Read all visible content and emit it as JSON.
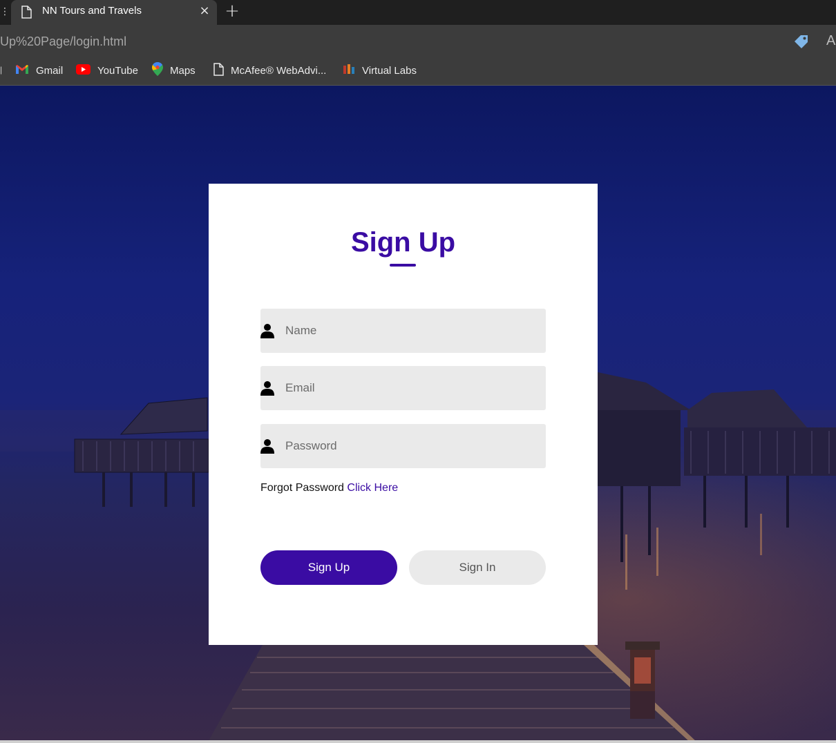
{
  "browser": {
    "tab_title": "NN Tours and Travels",
    "tab_close": "×",
    "new_tab": "+",
    "url": "Up%20Page/login.html",
    "read_aloud": "A",
    "bookmarks": [
      {
        "label": "Gmail",
        "icon": "gmail-icon"
      },
      {
        "label": "YouTube",
        "icon": "youtube-icon"
      },
      {
        "label": "Maps",
        "icon": "maps-icon"
      },
      {
        "label": "McAfee® WebAdvi...",
        "icon": "document-icon"
      },
      {
        "label": "Virtual Labs",
        "icon": "virtual-labs-icon"
      }
    ]
  },
  "form": {
    "title": "Sign Up",
    "fields": [
      {
        "placeholder": "Name",
        "value": ""
      },
      {
        "placeholder": "Email",
        "value": ""
      },
      {
        "placeholder": "Password",
        "value": ""
      }
    ],
    "forgot_text": "Forgot Password",
    "forgot_link": "Click Here",
    "signup_button": "Sign Up",
    "signin_button": "Sign In"
  },
  "colors": {
    "accent": "#3a0ca3",
    "input_bg": "#eaeaea",
    "secondary_button_bg": "#eaeaea",
    "chrome_bg": "#3c3c3c",
    "tabstrip_bg": "#1f1f1f"
  }
}
